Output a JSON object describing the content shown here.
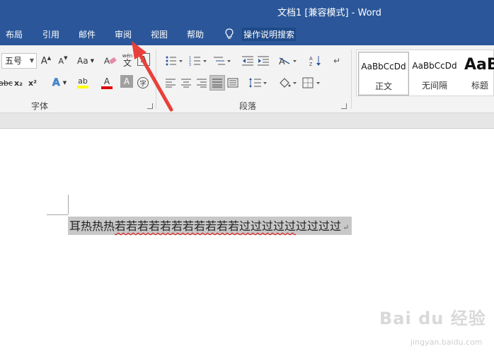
{
  "window": {
    "title": "文档1 [兼容模式] - Word"
  },
  "tabs": [
    {
      "label": "布局"
    },
    {
      "label": "引用"
    },
    {
      "label": "邮件"
    },
    {
      "label": "审阅"
    },
    {
      "label": "视图"
    },
    {
      "label": "帮助"
    }
  ],
  "tell_me": {
    "label": "操作说明搜索"
  },
  "font_group": {
    "font_size_value": "五号",
    "label": "字体",
    "case_label": "Aa",
    "grow_label": "A",
    "shrink_label": "A",
    "phonetic_top": "wén",
    "phonetic_char": "文",
    "char_border": "A",
    "strike_label": "abc",
    "sub_label": "x₂",
    "sup_label": "x²",
    "effects_label": "A",
    "highlight_label": "ab",
    "font_color_label": "A",
    "shade_label": "A",
    "enclose_label": "字",
    "highlight_color": "#ffff00",
    "font_color": "#e00000"
  },
  "paragraph_group": {
    "label": "段落"
  },
  "styles": [
    {
      "sample": "AaBbCcDd",
      "name": "正文"
    },
    {
      "sample": "AaBbCcDd",
      "name": "无间隔"
    },
    {
      "sample": "AaB",
      "name": "标题"
    }
  ],
  "document": {
    "text_plain": "耳热热热",
    "text_squiggle1": "若若若若若若若若若若若",
    "text_squiggle2": "过过过过过",
    "text_plain2": "过过过过"
  },
  "watermark": {
    "brand": "Bai du 经验",
    "url": "jingyan.baidu.com"
  },
  "colors": {
    "ribbon_blue": "#2b579a",
    "selection_gray": "#c8c8c8",
    "annotation_red": "#e8403a"
  }
}
